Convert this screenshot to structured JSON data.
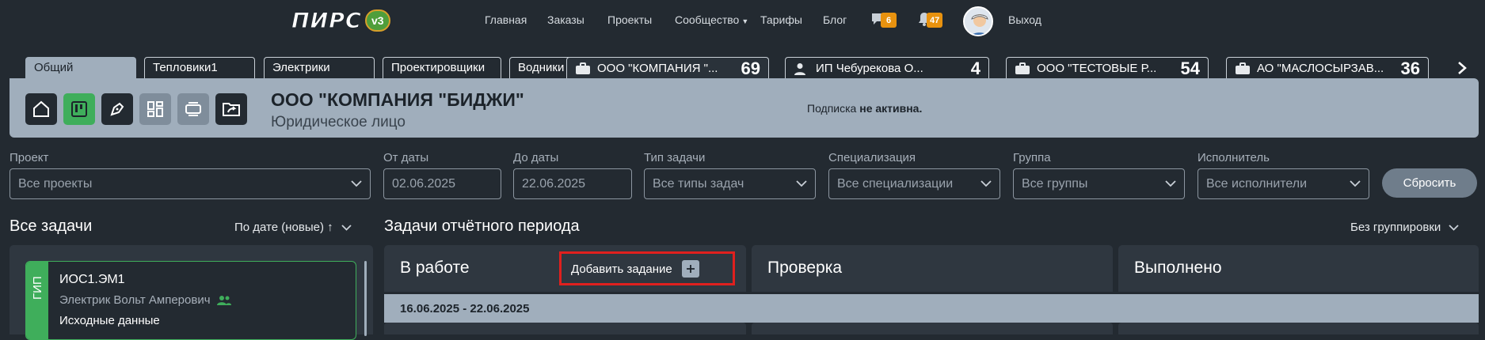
{
  "header": {
    "logo_text": "ПИРС",
    "logo_version": "v3",
    "nav": [
      "Главная",
      "Заказы",
      "Проекты",
      "Сообщество",
      "Тарифы",
      "Блог"
    ],
    "messages_count": "6",
    "notifications_count": "47",
    "logout": "Выход"
  },
  "tabs": [
    "Общий",
    "Тепловики1",
    "Электрики",
    "Проектировщики",
    "Водники"
  ],
  "company_tabs": [
    {
      "name": "ООО \"КОМПАНИЯ \"...",
      "count": "69"
    },
    {
      "name": "ИП Чебурекова О...",
      "count": "4"
    },
    {
      "name": "ООО \"ТЕСТОВЫЕ Р...",
      "count": "54"
    },
    {
      "name": "АО \"МАСЛОСЫРЗАВ...",
      "count": "36"
    }
  ],
  "company": {
    "name": "ООО \"КОМПАНИЯ \"БИДЖИ\"",
    "type": "Юридическое лицо",
    "subscription_prefix": "Подписка ",
    "subscription_status": "не активна."
  },
  "filters": {
    "project": {
      "label": "Проект",
      "value": "Все проекты"
    },
    "from_date": {
      "label": "От даты",
      "value": "02.06.2025"
    },
    "to_date": {
      "label": "До даты",
      "value": "22.06.2025"
    },
    "task_type": {
      "label": "Тип задачи",
      "value": "Все типы задач"
    },
    "specialization": {
      "label": "Специализация",
      "value": "Все специализации"
    },
    "group": {
      "label": "Группа",
      "value": "Все группы"
    },
    "executor": {
      "label": "Исполнитель",
      "value": "Все исполнители"
    },
    "reset": "Сбросить"
  },
  "all_tasks": {
    "title": "Все задачи",
    "sort": "По дате (новые) ↑",
    "card": {
      "stripe": "ГИП",
      "code": "ИОС1.ЭМ1",
      "person": "Электрик Вольт Амперович",
      "stage": "Исходные данные"
    }
  },
  "period": {
    "title": "Задачи отчётного периода",
    "grouping": "Без группировки",
    "columns": [
      "В работе",
      "Проверка",
      "Выполнено"
    ],
    "add_task": "Добавить задание",
    "date_range": "16.06.2025 - 22.06.2025"
  },
  "colors": {
    "accent_green": "#3fae5b",
    "badge_orange": "#e8920f",
    "panel": "#a0aebc",
    "highlight_red": "#e0201e"
  }
}
